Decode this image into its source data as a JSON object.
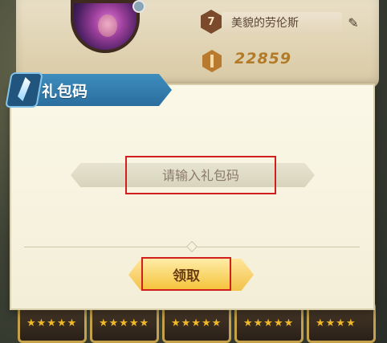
{
  "profile": {
    "level": "7",
    "player_name": "美貌的劳伦斯",
    "power": "22859"
  },
  "dialog": {
    "title": "礼包码",
    "code_placeholder": "请输入礼包码",
    "claim_label": "领取"
  },
  "cards": [
    {
      "stars": "★★★★★"
    },
    {
      "stars": "★★★★★"
    },
    {
      "stars": "★★★★★"
    },
    {
      "stars": "★★★★★"
    },
    {
      "stars": "★★★★"
    }
  ],
  "colors": {
    "highlight_box": "#d11f1f",
    "title_banner": "#2a6e9e",
    "claim_button": "#f4c43c",
    "power_text": "#b37a27"
  },
  "icons": {
    "edit": "pencil-icon",
    "power": "sword-icon",
    "title_emblem": "feather-icon",
    "badge": "gear-icon"
  }
}
